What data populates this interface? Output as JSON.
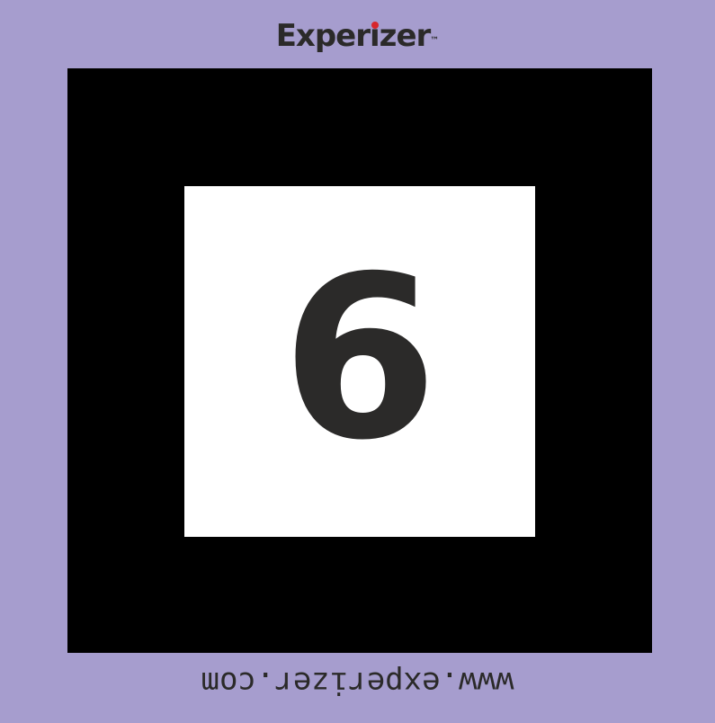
{
  "logo": {
    "prefix": "Exper",
    "i_letter": "ı",
    "suffix": "zer",
    "trademark": "™"
  },
  "marker": {
    "number": "6"
  },
  "footer": {
    "url": "www.experizer.com"
  },
  "colors": {
    "background": "#a69dce",
    "frame": "#000000",
    "inner": "#ffffff",
    "text": "#2b2a29",
    "logo_dot": "#d7262c"
  }
}
